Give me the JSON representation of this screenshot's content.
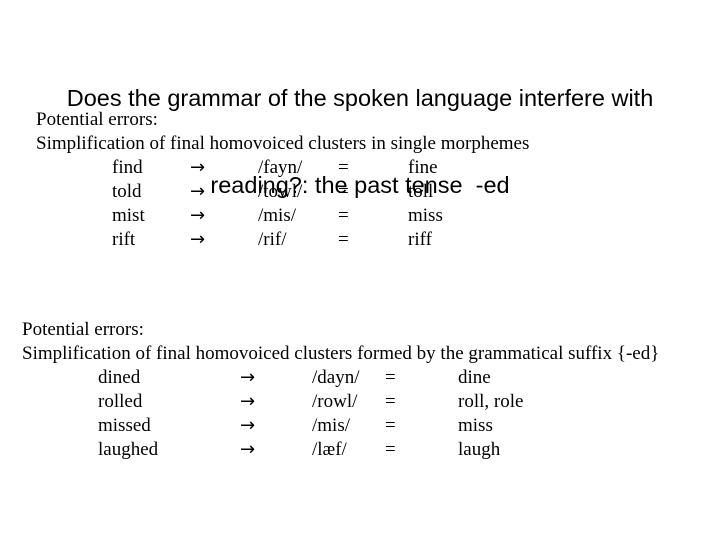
{
  "slide": {
    "title": {
      "line1": "Does the grammar of the spoken language interfere with",
      "line2": "reading?: the past tense  -ed"
    },
    "block_one": {
      "lead1": "Potential errors:",
      "lead2": "Simplification of final homovoiced clusters in single morphemes",
      "table": {
        "arrow": "→",
        "equals": "=",
        "rows": [
          {
            "word": "find",
            "arrow": "→",
            "phoneme": "/fayn/",
            "equals": "=",
            "result": "fine"
          },
          {
            "word": "told",
            "arrow": "→",
            "phoneme": "/towl/",
            "equals": "=",
            "result": "toll"
          },
          {
            "word": "mist",
            "arrow": "→",
            "phoneme": "/mis/",
            "equals": "=",
            "result": "miss"
          },
          {
            "word": "rift",
            "arrow": "→",
            "phoneme": "/rif/",
            "equals": "=",
            "result": "riff"
          }
        ]
      }
    },
    "block_two": {
      "lead1": "Potential errors:",
      "lead2": "Simplification of final homovoiced clusters formed by the grammatical suffix {-ed}",
      "table": {
        "arrow": "→",
        "equals": "=",
        "rows": [
          {
            "word": "dined",
            "arrow": "→",
            "phoneme": "/dayn/",
            "equals": "=",
            "result": "dine"
          },
          {
            "word": "rolled",
            "arrow": "→",
            "phoneme": "/rowl/",
            "equals": "=",
            "result": "roll, role"
          },
          {
            "word": "missed",
            "arrow": "→",
            "phoneme": "/mis/",
            "equals": "=",
            "result": "miss"
          },
          {
            "word": "laughed",
            "arrow": "→",
            "phoneme": "/læf/",
            "equals": "=",
            "result": "laugh"
          }
        ]
      }
    },
    "colors": {
      "background": "#ffffff",
      "text": "#000000"
    }
  }
}
